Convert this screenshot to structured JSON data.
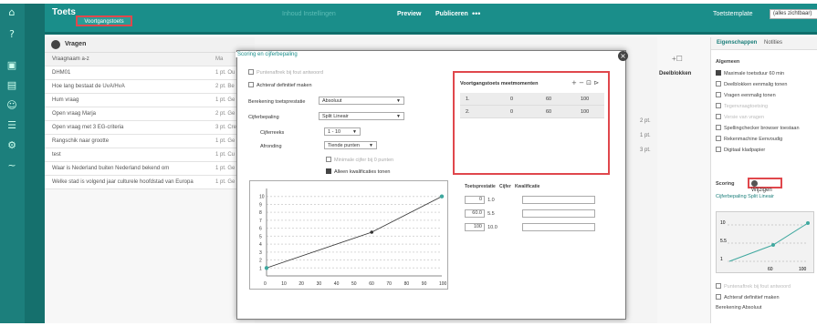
{
  "topbar": {
    "app_title": "Toets",
    "status_badge": "Voortgangstoets",
    "faint_tabs": "Inhoud  Instellingen",
    "preview": "Preview",
    "publish": "Publiceren",
    "more": "•••",
    "template_label": "Toetstemplate",
    "template_value": "(alles zichtbaar)"
  },
  "questions": {
    "title": "Vragen",
    "rows": [
      {
        "text": "Vraagnaam a-z",
        "points": "Ma"
      },
      {
        "text": "DHM01",
        "points": "1 pt. Ou"
      },
      {
        "text": "Hoe lang bestaat de UvA/HvA",
        "points": "2 pt. Be"
      },
      {
        "text": "Hum vraag",
        "points": "1 pt. Ge"
      },
      {
        "text": "Open vraag Marja",
        "points": "2 pt. Ge"
      },
      {
        "text": "Open vraag met 3 EG-criteria",
        "points": "3 pt. Cre"
      },
      {
        "text": "Rangschik naar grootte",
        "points": "1 pt. Ge"
      },
      {
        "text": "test",
        "points": "1 pt. Cu"
      },
      {
        "text": "Waar is Nederland buiten Nederland bekend om",
        "points": "1 pt. Ge"
      },
      {
        "text": "Welke stad is volgend jaar culturele hoofdstad van Europa",
        "points": "1 pt. Ge"
      }
    ]
  },
  "middle_strip": {
    "deelblokken": "Deelblokken",
    "pt2": "2 pt.",
    "pt1": "1 pt.",
    "pt3": "3 pt."
  },
  "dialog": {
    "title": "Scoring en cijferbepaling",
    "punten_check": "Puntenaftrek bij fout antwoord",
    "achteraf": "Achteraf definitief maken",
    "berekening_label": "Berekening toetsprestatie",
    "berekening_value": "Absoluut",
    "cijfer_label": "Cijferbepaling",
    "cijfer_value": "Split Lineair",
    "reeks_label": "Cijferreeks",
    "reeks_value": "1 - 10",
    "afronding_label": "Afronding",
    "afronding_value": "Tiende punten",
    "minimale": "Minimale cijfer bij 0 punten",
    "alleen_kwal": "Alleen kwalificaties tonen",
    "momenten": {
      "title": "Voortgangstoets meetmomenten",
      "icons": "+  −  ⊡  ⊳",
      "rows": [
        [
          "1.",
          "0",
          "60",
          "100"
        ],
        [
          "2.",
          "0",
          "60",
          "100"
        ]
      ]
    },
    "toets_head": {
      "prestatie": "Toetsprestatie",
      "cijfer": "Cijfer",
      "kwal": "Kwalificatie"
    },
    "toets_rows": [
      {
        "p": "0",
        "c": "1.0"
      },
      {
        "p": "60.0",
        "c": "5.5"
      },
      {
        "p": "100",
        "c": "10.0"
      }
    ]
  },
  "chart_data": {
    "type": "line",
    "x": [
      0,
      60,
      100
    ],
    "y": [
      1,
      5.5,
      10
    ],
    "xticks": [
      "0",
      "10",
      "20",
      "30",
      "40",
      "50",
      "60",
      "70",
      "80",
      "90",
      "100"
    ],
    "yticks": [
      "1",
      "2",
      "3",
      "4",
      "5",
      "6",
      "7",
      "8",
      "9",
      "10"
    ],
    "xlim": [
      0,
      100
    ],
    "ylim": [
      0,
      11
    ],
    "color": "#3fa89f"
  },
  "props": {
    "tab_active": "Eigenschappen",
    "tab2": "Notities",
    "algemeen": "Algemeen",
    "rows": [
      "Maximale toetsduur  60  min",
      "Deelblokken eenmalig tonen",
      "Vragen eenmalig tonen",
      "Tegenvraagtoetsing",
      "Versie van vragen",
      "Spellingchecker browser toestaan",
      "Rekenmachine  Eenvoudig",
      "Digitaal kladpapier"
    ],
    "scoring": "Scoring",
    "wijzigen": "Wijzigen",
    "cijferbepaling": "Cijferbepaling  Split Lineair",
    "mini": {
      "y10": "10",
      "y55": "5.5",
      "y1": "1",
      "x60": "60",
      "x100": "100"
    },
    "punten": "Puntenaftrek bij fout antwoord",
    "achteraf": "Achteraf definitief maken",
    "berekening": "Berekening  Absoluut"
  }
}
